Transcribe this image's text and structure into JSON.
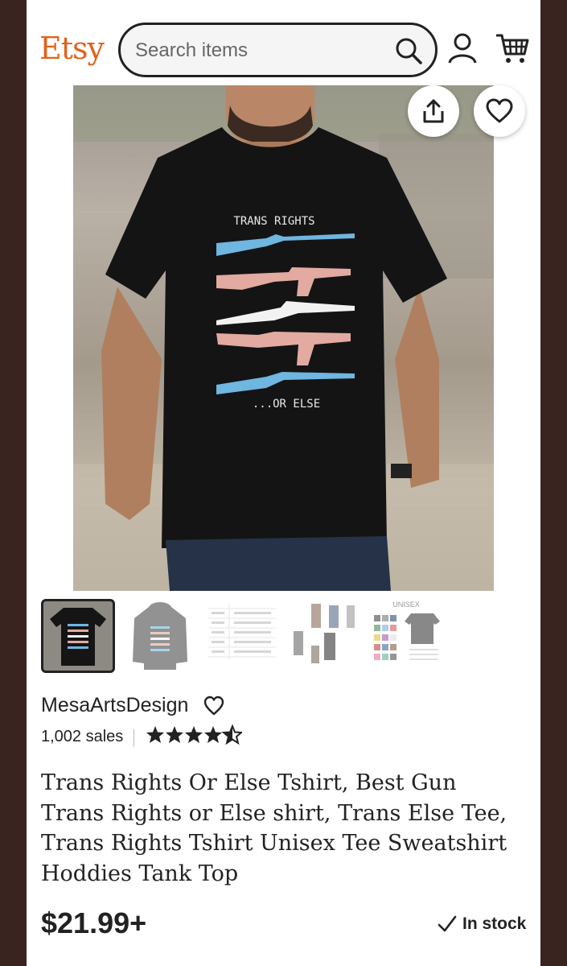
{
  "header": {
    "logo": "Etsy",
    "search_placeholder": "Search items"
  },
  "product_image": {
    "shirt_text_top": "TRANS RIGHTS",
    "shirt_text_bottom": "...OR ELSE"
  },
  "thumbnails": [
    {
      "kind": "black tee",
      "selected": true
    },
    {
      "kind": "grey hoodie",
      "selected": false
    },
    {
      "kind": "size chart",
      "selected": false
    },
    {
      "kind": "model collage",
      "selected": false
    },
    {
      "kind": "unisex colors",
      "label": "UNISEX",
      "selected": false
    }
  ],
  "shop": {
    "name": "MesaArtsDesign",
    "sales": "1,002 sales",
    "rating": 4.5
  },
  "listing": {
    "title": "Trans Rights Or Else Tshirt, Best Gun Trans Rights or Else shirt, Trans Else Tee, Trans Rights Tshirt Unisex Tee Sweatshirt Hoddies Tank Top",
    "price": "$21.99+",
    "stock": "In stock"
  },
  "colors": {
    "brand": "#e0631e",
    "text": "#222222",
    "flag_blue": "#6fb6e0",
    "flag_pink": "#e2aaa0",
    "flag_white": "#f2f2f2"
  }
}
